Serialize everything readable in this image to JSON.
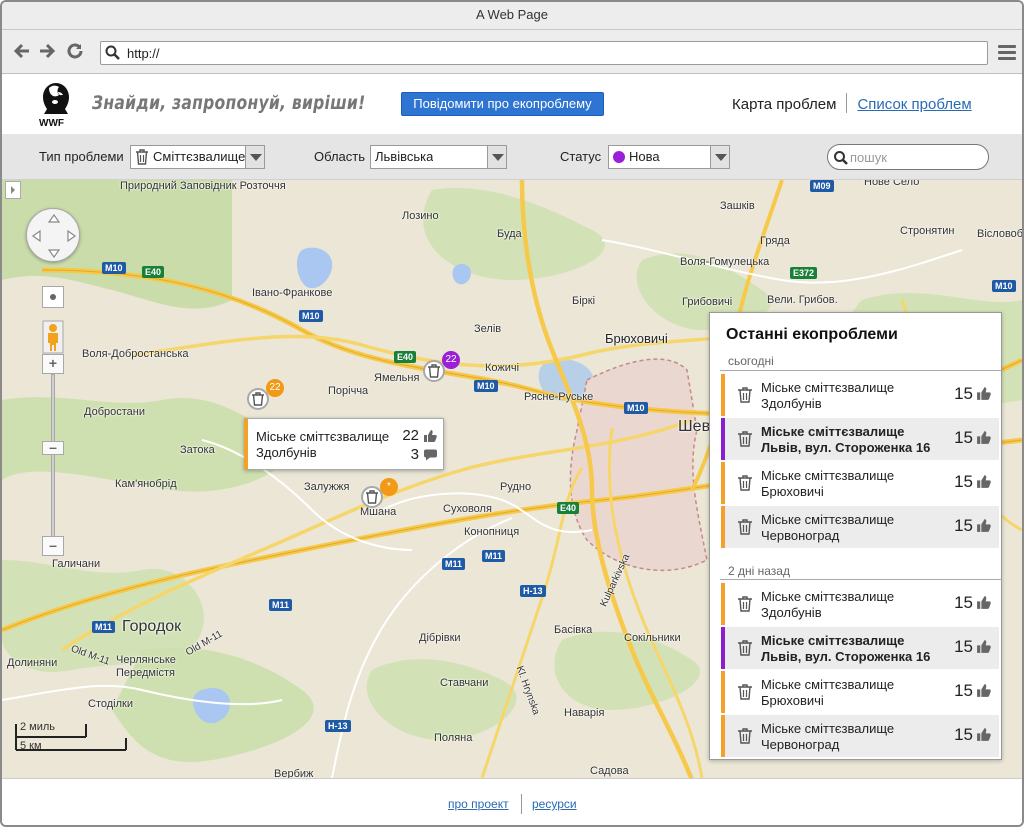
{
  "browser": {
    "title": "A Web Page",
    "url": "http://"
  },
  "header": {
    "logo_text": "WWF",
    "slogan": "Знайди, запропонуй, виріши!",
    "report_button": "Повідомити про екопроблему",
    "nav_map": "Карта проблем",
    "nav_list": "Список проблем"
  },
  "filters": {
    "type_label": "Тип проблеми",
    "type_value": "Сміттєзвалище",
    "region_label": "Область",
    "region_value": "Львівська",
    "status_label": "Статус",
    "status_value": "Нова",
    "status_color": "#9b1fd6",
    "search_placeholder": "пошук"
  },
  "map": {
    "labels": [
      "Природний Заповідник Розточчя",
      "Лозино",
      "Буда",
      "Зашків",
      "Нове Село",
      "Гряда",
      "Стронятин",
      "Вісловоб",
      "Воля-Гомулецька",
      "Грибовичі",
      "Вели. Грибов.",
      "Брюховичі",
      "Біркі",
      "Зелів",
      "Кожичі",
      "Ямельня",
      "Рясне-Руське",
      "Івано-Франкове",
      "Воля-Добростанська",
      "Порічча",
      "Добростани",
      "Затока",
      "Кам'янобрід",
      "Залужжя",
      "Мшана",
      "Суховоля",
      "Рудно",
      "Конопниця",
      "Галичани",
      "Городок",
      "Долиняни",
      "Черлянське Передмістя",
      "Стоділки",
      "Дібрівки",
      "Басівка",
      "Сокільники",
      "Ставчани",
      "Наварія",
      "Поляна",
      "Садова",
      "Вербиж",
      "Шев"
    ],
    "road_shields": [
      "M10",
      "E40",
      "M10",
      "M10",
      "E40",
      "M10",
      "M10",
      "E40",
      "M09",
      "E372",
      "M11",
      "M11",
      "M11",
      "M11",
      "H-13",
      "H-13",
      "Old M-11",
      "Old M-11",
      "Kulparkivska",
      "Kl. Hrynska"
    ],
    "scale_top": "2 миль",
    "scale_bottom": "5 км",
    "markers": [
      {
        "count": "22",
        "color": "#f29a18"
      },
      {
        "count": "22",
        "color": "#9b1fd6"
      },
      {
        "count": "*",
        "color": "#f29a18"
      }
    ],
    "popup": {
      "title_line1": "Міське сміттєзвалище",
      "title_line2": "Здолбунів",
      "likes": "22",
      "comments": "3"
    }
  },
  "panel": {
    "title": "Останні екопроблеми",
    "groups": [
      {
        "label": "сьогодні",
        "items": [
          {
            "line1": "Міське сміттєзвалище",
            "line2": "Здолбунів",
            "votes": "15",
            "status": "orange",
            "bold": false
          },
          {
            "line1": "Міське сміттєзвалище",
            "line2": "Львів, вул. Стороженка 16",
            "votes": "15",
            "status": "purple",
            "bold": true
          },
          {
            "line1": "Міське сміттєзвалище",
            "line2": "Брюховичі",
            "votes": "15",
            "status": "orange",
            "bold": false
          },
          {
            "line1": "Міське сміттєзвалище",
            "line2": "Червоноград",
            "votes": "15",
            "status": "orange",
            "bold": false
          }
        ]
      },
      {
        "label": "2 дні назад",
        "items": [
          {
            "line1": "Міське сміттєзвалище",
            "line2": "Здолбунів",
            "votes": "15",
            "status": "orange",
            "bold": false
          },
          {
            "line1": "Міське сміттєзвалище",
            "line2": "Львів, вул. Стороженка 16",
            "votes": "15",
            "status": "purple",
            "bold": true
          },
          {
            "line1": "Міське сміттєзвалище",
            "line2": "Брюховичі",
            "votes": "15",
            "status": "orange",
            "bold": false
          },
          {
            "line1": "Міське сміттєзвалище",
            "line2": "Червоноград",
            "votes": "15",
            "status": "orange",
            "bold": false
          }
        ]
      }
    ]
  },
  "footer": {
    "about": "про проект",
    "resources": "ресурси"
  },
  "colors": {
    "accent_blue": "#2e74d2",
    "status_new": "#9b1fd6",
    "status_orange": "#f29a18"
  }
}
